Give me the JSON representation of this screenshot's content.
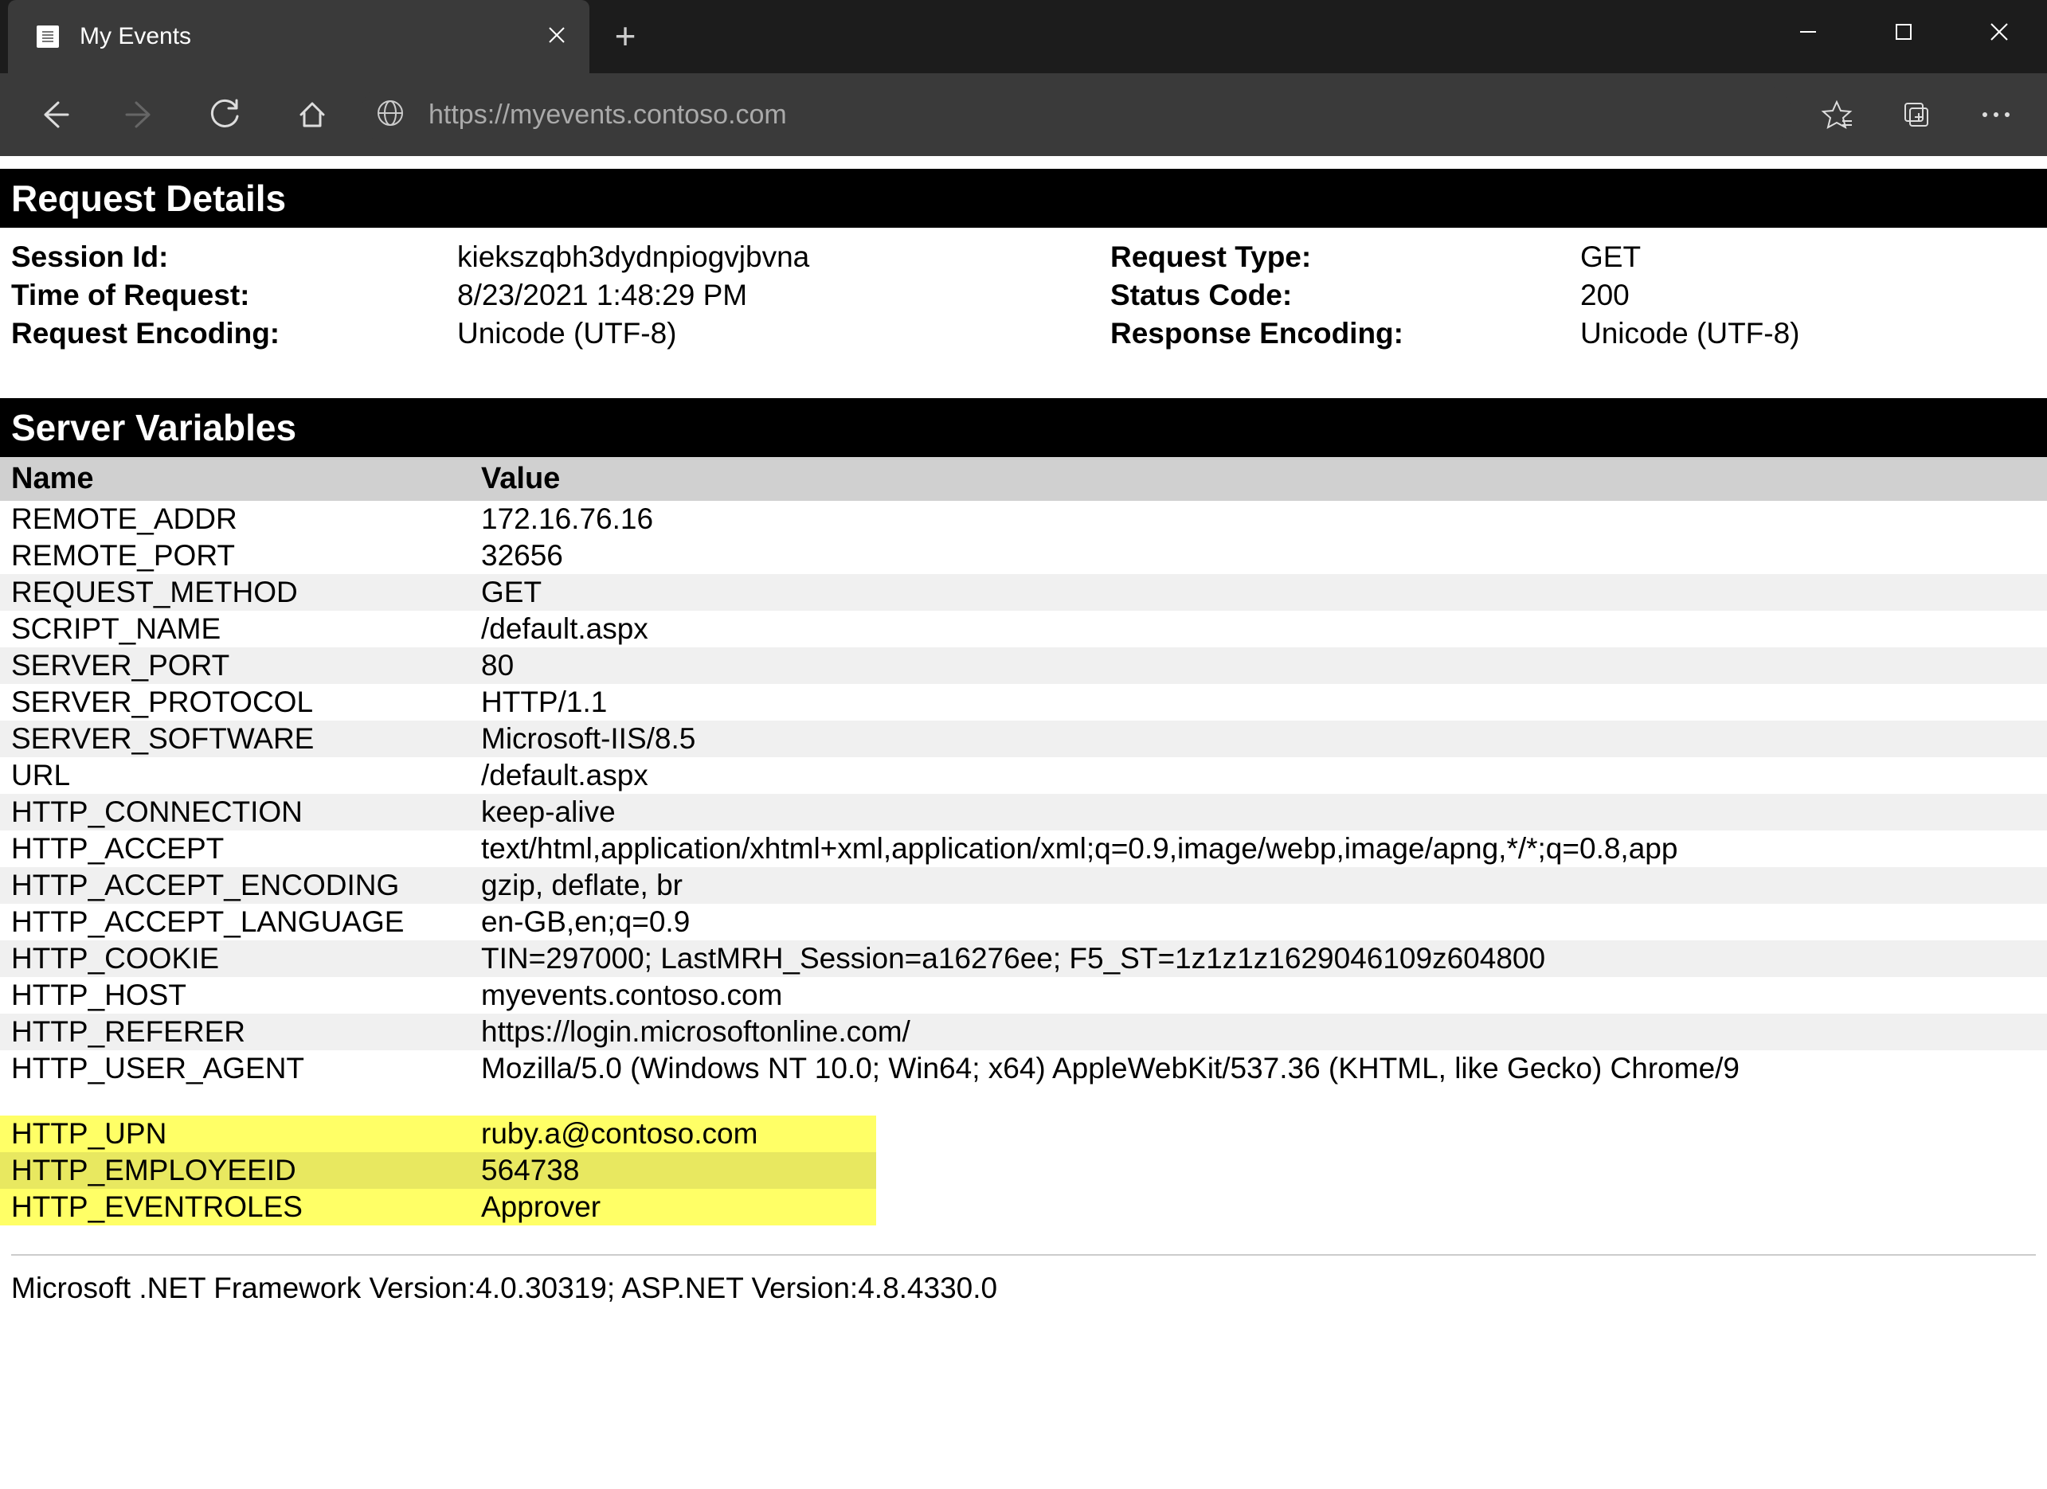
{
  "tab": {
    "title": "My Events"
  },
  "addressbar": {
    "url": "https://myevents.contoso.com"
  },
  "sections": {
    "request_details_header": "Request Details",
    "server_variables_header": "Server Variables"
  },
  "request_details": {
    "labels": {
      "session_id": "Session Id:",
      "time_of_request": "Time of Request:",
      "request_encoding": "Request Encoding:",
      "request_type": "Request Type:",
      "status_code": "Status Code:",
      "response_encoding": "Response Encoding:"
    },
    "values": {
      "session_id": "kiekszqbh3dydnpiogvjbvna",
      "time_of_request": "8/23/2021 1:48:29 PM",
      "request_encoding": "Unicode (UTF-8)",
      "request_type": "GET",
      "status_code": "200",
      "response_encoding": "Unicode (UTF-8)"
    }
  },
  "server_variables": {
    "columns": {
      "name": "Name",
      "value": "Value"
    },
    "rows": [
      {
        "name": "REMOTE_ADDR",
        "value": "172.16.76.16"
      },
      {
        "name": "REMOTE_PORT",
        "value": "32656"
      },
      {
        "name": "REQUEST_METHOD",
        "value": "GET"
      },
      {
        "name": "SCRIPT_NAME",
        "value": "/default.aspx"
      },
      {
        "name": "SERVER_PORT",
        "value": "80"
      },
      {
        "name": "SERVER_PROTOCOL",
        "value": "HTTP/1.1"
      },
      {
        "name": "SERVER_SOFTWARE",
        "value": "Microsoft-IIS/8.5"
      },
      {
        "name": "URL",
        "value": "/default.aspx"
      },
      {
        "name": "HTTP_CONNECTION",
        "value": "keep-alive"
      },
      {
        "name": "HTTP_ACCEPT",
        "value": "text/html,application/xhtml+xml,application/xml;q=0.9,image/webp,image/apng,*/*;q=0.8,app"
      },
      {
        "name": "HTTP_ACCEPT_ENCODING",
        "value": "gzip, deflate, br"
      },
      {
        "name": "HTTP_ACCEPT_LANGUAGE",
        "value": "en-GB,en;q=0.9"
      },
      {
        "name": "HTTP_COOKIE",
        "value": "TIN=297000; LastMRH_Session=a16276ee; F5_ST=1z1z1z1629046109z604800"
      },
      {
        "name": "HTTP_HOST",
        "value": "myevents.contoso.com"
      },
      {
        "name": "HTTP_REFERER",
        "value": "https://login.microsoftonline.com/"
      },
      {
        "name": "HTTP_USER_AGENT",
        "value": "Mozilla/5.0 (Windows NT 10.0; Win64; x64) AppleWebKit/537.36 (KHTML, like Gecko) Chrome/9"
      }
    ],
    "highlight_rows": [
      {
        "name": "HTTP_UPN",
        "value": "ruby.a@contoso.com"
      },
      {
        "name": "HTTP_EMPLOYEEID",
        "value": "564738"
      },
      {
        "name": "HTTP_EVENTROLES",
        "value": "Approver"
      }
    ]
  },
  "footer": "Microsoft .NET Framework Version:4.0.30319; ASP.NET Version:4.8.4330.0"
}
